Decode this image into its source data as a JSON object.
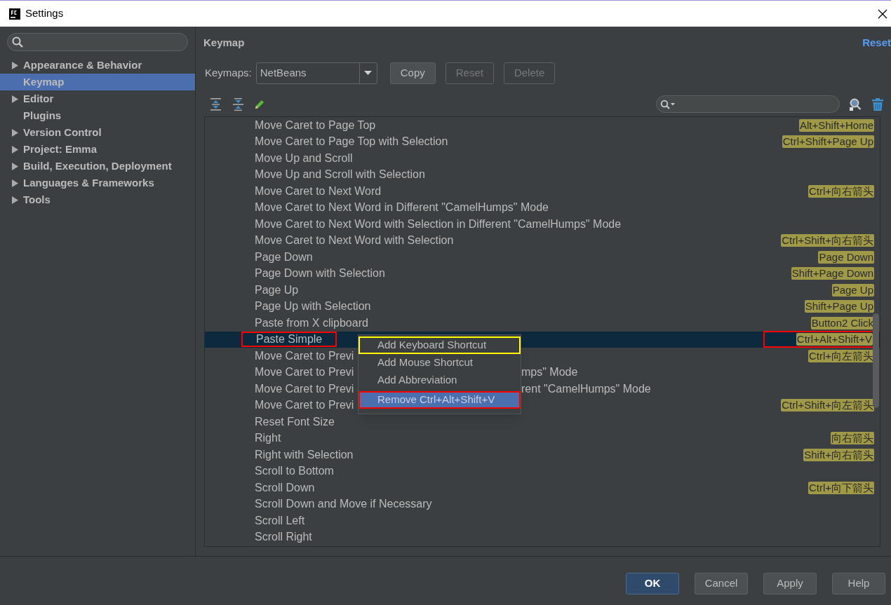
{
  "window": {
    "title": "Settings"
  },
  "sidebar": {
    "items": [
      {
        "label": "Appearance & Behavior",
        "kind": "group",
        "selected": false
      },
      {
        "label": "Keymap",
        "kind": "leaf",
        "selected": true
      },
      {
        "label": "Editor",
        "kind": "group",
        "selected": false
      },
      {
        "label": "Plugins",
        "kind": "leaf",
        "selected": false
      },
      {
        "label": "Version Control",
        "kind": "group",
        "selected": false
      },
      {
        "label": "Project: Emma",
        "kind": "group",
        "selected": false
      },
      {
        "label": "Build, Execution, Deployment",
        "kind": "group",
        "selected": false
      },
      {
        "label": "Languages & Frameworks",
        "kind": "group",
        "selected": false
      },
      {
        "label": "Tools",
        "kind": "group",
        "selected": false
      }
    ]
  },
  "header": {
    "title": "Keymap",
    "reset_link": "Reset"
  },
  "keymap": {
    "label": "Keymaps:",
    "value": "NetBeans",
    "buttons": [
      {
        "label": "Copy",
        "disabled": false
      },
      {
        "label": "Reset",
        "disabled": true
      },
      {
        "label": "Delete",
        "disabled": true
      }
    ]
  },
  "actions": {
    "rows": [
      {
        "name": "Move Caret to Page Top",
        "shortcut": "Alt+Shift+Home",
        "selected": false
      },
      {
        "name": "Move Caret to Page Top with Selection",
        "shortcut": "Ctrl+Shift+Page Up",
        "selected": false
      },
      {
        "name": "Move Up and Scroll",
        "selected": false
      },
      {
        "name": "Move Up and Scroll with Selection",
        "selected": false
      },
      {
        "name": "Move Caret to Next Word",
        "shortcut": "Ctrl+向右箭头",
        "selected": false
      },
      {
        "name": "Move Caret to Next Word in Different \"CamelHumps\" Mode",
        "selected": false
      },
      {
        "name": "Move Caret to Next Word with Selection in Different \"CamelHumps\" Mode",
        "selected": false
      },
      {
        "name": "Move Caret to Next Word with Selection",
        "shortcut": "Ctrl+Shift+向右箭头",
        "selected": false
      },
      {
        "name": "Page Down",
        "shortcut": "Page Down",
        "selected": false
      },
      {
        "name": "Page Down with Selection",
        "shortcut": "Shift+Page Down",
        "selected": false
      },
      {
        "name": "Page Up",
        "shortcut": "Page Up",
        "selected": false
      },
      {
        "name": "Page Up with Selection",
        "shortcut": "Shift+Page Up",
        "selected": false
      },
      {
        "name": "Paste from X clipboard",
        "shortcut": "Button2 Click",
        "selected": false
      },
      {
        "name": "Paste Simple",
        "shortcut": "Ctrl+Alt+Shift+V",
        "selected": true,
        "highlighted": true
      },
      {
        "name": "Move Caret to Previ",
        "shortcut": "Ctrl+向左箭头",
        "selected": false
      },
      {
        "name": "Move Caret to Previ",
        "tail": "mps\" Mode",
        "selected": false
      },
      {
        "name": "Move Caret to Previ",
        "tail": "rent \"CamelHumps\" Mode",
        "selected": false
      },
      {
        "name": "Move Caret to Previ",
        "shortcut": "Ctrl+Shift+向左箭头",
        "selected": false
      },
      {
        "name": "Reset Font Size",
        "selected": false
      },
      {
        "name": "Right",
        "shortcut": "向右箭头",
        "selected": false
      },
      {
        "name": "Right with Selection",
        "shortcut": "Shift+向右箭头",
        "selected": false
      },
      {
        "name": "Scroll to Bottom",
        "selected": false
      },
      {
        "name": "Scroll Down",
        "shortcut": "Ctrl+向下箭头",
        "selected": false
      },
      {
        "name": "Scroll Down and Move if Necessary",
        "selected": false
      },
      {
        "name": "Scroll Left",
        "selected": false
      },
      {
        "name": "Scroll Right",
        "selected": false
      }
    ]
  },
  "context_menu": {
    "items": [
      {
        "label": "Add Keyboard Shortcut",
        "selected": false,
        "color": "#ffff00"
      },
      {
        "label": "Add Mouse Shortcut",
        "selected": false
      },
      {
        "label": "Add Abbreviation",
        "selected": false
      },
      {
        "label": "Remove Ctrl+Alt+Shift+V",
        "selected": true,
        "color": "#ff0000"
      }
    ]
  },
  "footer": {
    "buttons": [
      {
        "label": "OK",
        "default": true
      },
      {
        "label": "Cancel",
        "default": false
      },
      {
        "label": "Apply",
        "default": false
      },
      {
        "label": "Help",
        "default": false
      }
    ]
  }
}
